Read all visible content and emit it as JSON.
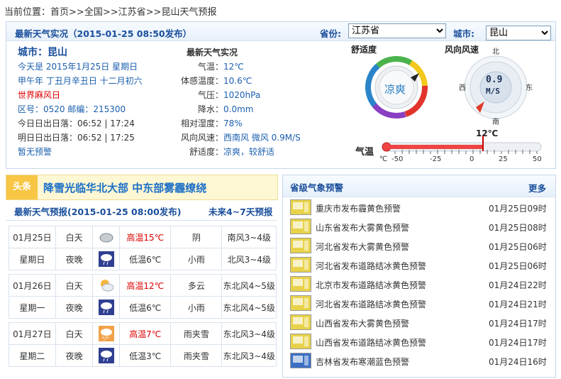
{
  "breadcrumb": {
    "prefix": "当前位置：",
    "home": "首页",
    "country": "全国",
    "province": "江苏省",
    "current": "昆山天气预报",
    "sep": ">>"
  },
  "live": {
    "title": "最新天气实况（2015-01-25 08:50发布）",
    "province_label": "省份:",
    "province_value": "江苏省",
    "city_label": "城市:",
    "city_value": "昆山",
    "city_title": "城市：昆山",
    "today": "今天是 2015年1月25日 星期日",
    "lunar": "甲午年 丁丑月辛丑日 十二月初六",
    "special_day": "世界麻风日",
    "codes": "区号：0520   邮编：215300",
    "sun_today": "今日日出日落：06:52 | 17:24",
    "sun_tomorrow": "明日日出日落：06:52 | 17:25",
    "no_warning": "暂无预警",
    "detail_title": "最新天气实况",
    "details": [
      {
        "label": "气温：",
        "value": "12℃"
      },
      {
        "label": "体感温度：",
        "value": "10.6℃"
      },
      {
        "label": "气压：",
        "value": "1020hPa"
      },
      {
        "label": "降水：",
        "value": "0.0mm"
      },
      {
        "label": "相对湿度：",
        "value": "78%"
      },
      {
        "label": "风向风速：",
        "value": "西南风 微风 0.9M/S"
      },
      {
        "label": "舒适度：",
        "value": "凉爽，较舒适"
      }
    ],
    "comfort_title": "舒适度",
    "comfort_value": "凉爽",
    "wind_title": "风向风速",
    "wind_speed": "0.9",
    "wind_unit": "M/S",
    "compass": {
      "n": "北",
      "s": "南",
      "e": "东",
      "w": "西"
    },
    "temp_title": "气温",
    "temp_value": "12℃",
    "temp_current": 12,
    "temp_scale": [
      "℃",
      "-50",
      "-25",
      "0",
      "25",
      "50"
    ]
  },
  "headline": {
    "tag": "头条",
    "text": "降雪光临华北大部 中东部雾霾缭绕"
  },
  "forecast": {
    "title": "最新天气预报(2015-01-25 08:00发布)",
    "more": "未来4~7天预报",
    "days": [
      {
        "date": "01月25日",
        "weekday": "星期日",
        "day": {
          "period": "白天",
          "temp": "高温15℃",
          "weather": "阴",
          "wind": "南风3~4级",
          "icon": "overcast-icon"
        },
        "night": {
          "period": "夜晚",
          "temp": "低温6℃",
          "weather": "小雨",
          "wind": "北风3~4级",
          "icon": "light-rain-night-icon"
        }
      },
      {
        "date": "01月26日",
        "weekday": "星期一",
        "day": {
          "period": "白天",
          "temp": "高温12℃",
          "weather": "多云",
          "wind": "东北风4~5级",
          "icon": "cloudy-sun-icon"
        },
        "night": {
          "period": "夜晚",
          "temp": "低温6℃",
          "weather": "小雨",
          "wind": "东北风4~5级",
          "icon": "light-rain-night-icon"
        }
      },
      {
        "date": "01月27日",
        "weekday": "星期二",
        "day": {
          "period": "白天",
          "temp": "高温7℃",
          "weather": "雨夹雪",
          "wind": "东北风3~4级",
          "icon": "sleet-day-icon"
        },
        "night": {
          "period": "夜晚",
          "temp": "低温3℃",
          "weather": "雨夹雪",
          "wind": "东北风3~4级",
          "icon": "sleet-night-icon"
        }
      }
    ]
  },
  "alerts": {
    "title": "省级气象预警",
    "more": "更多",
    "items": [
      {
        "text": "重庆市发布霾黄色预警",
        "time": "01月25日09时",
        "icon": "haze-yellow-icon"
      },
      {
        "text": "山东省发布大雾黄色预警",
        "time": "01月25日08时",
        "icon": "fog-yellow-icon"
      },
      {
        "text": "河北省发布大雾黄色预警",
        "time": "01月25日06时",
        "icon": "fog-yellow-icon"
      },
      {
        "text": "河北省发布道路结冰黄色预警",
        "time": "01月25日06时",
        "icon": "icy-road-yellow-icon"
      },
      {
        "text": "北京市发布道路结冰黄色预警",
        "time": "01月24日22时",
        "icon": "icy-road-yellow-icon"
      },
      {
        "text": "河北省发布道路结冰黄色预警",
        "time": "01月24日21时",
        "icon": "icy-road-yellow-icon"
      },
      {
        "text": "山西省发布大雾黄色预警",
        "time": "01月24日17时",
        "icon": "fog-yellow-icon"
      },
      {
        "text": "山西省发布道路结冰黄色预警",
        "time": "01月24日17时",
        "icon": "icy-road-yellow-icon"
      },
      {
        "text": "吉林省发布寒潮蓝色预警",
        "time": "01月24日16时",
        "icon": "cold-wave-blue-icon"
      }
    ]
  },
  "colors": {
    "accent_blue": "#1a4f9c",
    "red": "#dd0000",
    "headline_bg": "#fdf7d4",
    "alert_yellow": "#e8d24a",
    "alert_blue": "#3b6fc4"
  }
}
